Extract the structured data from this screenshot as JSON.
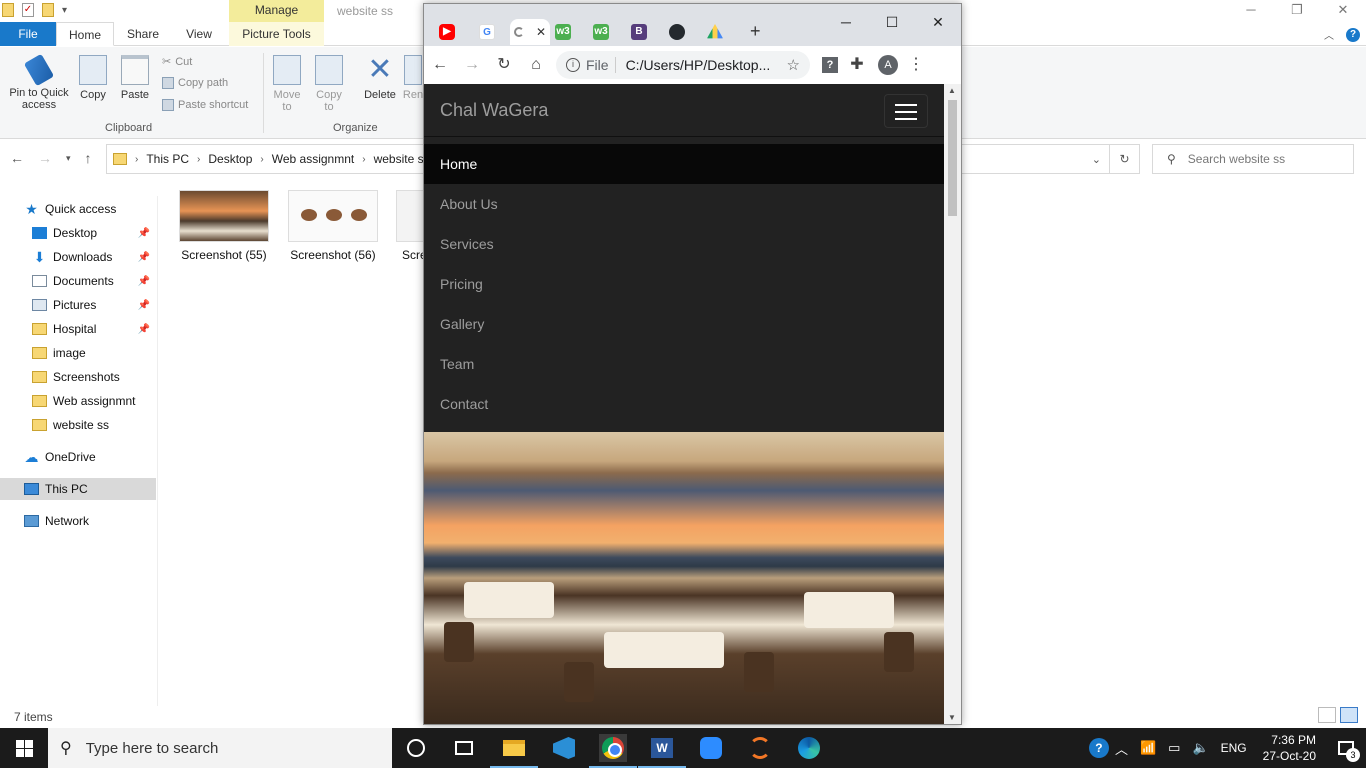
{
  "explorer": {
    "window_title": "website ss",
    "manage_label": "Manage",
    "tabs": {
      "file": "File",
      "home": "Home",
      "share": "Share",
      "view": "View",
      "picture_tools": "Picture Tools"
    },
    "ribbon": {
      "pin": [
        "Pin to Quick",
        "access"
      ],
      "copy": "Copy",
      "paste": "Paste",
      "cut": "Cut",
      "copy_path": "Copy path",
      "paste_shortcut": "Paste shortcut",
      "clipboard_group": "Clipboard",
      "move_to": [
        "Move",
        "to"
      ],
      "copy_to": [
        "Copy",
        "to"
      ],
      "delete": "Delete",
      "rename": "Ren",
      "organize_group": "Organize"
    },
    "breadcrumb": [
      "This PC",
      "Desktop",
      "Web assignmnt",
      "website s"
    ],
    "search_placeholder": "Search website ss",
    "nav": {
      "quick_access": "Quick access",
      "desktop": "Desktop",
      "downloads": "Downloads",
      "documents": "Documents",
      "pictures": "Pictures",
      "hospital": "Hospital",
      "image": "image",
      "screenshots": "Screenshots",
      "web_assignmnt": "Web assignmnt",
      "website_ss": "website ss",
      "onedrive": "OneDrive",
      "this_pc": "This PC",
      "network": "Network"
    },
    "files": [
      "Screenshot (55)",
      "Screenshot (56)",
      "Scre"
    ],
    "status": "7 items"
  },
  "chrome": {
    "address_scheme": "File",
    "address_url": "C:/Users/HP/Desktop...",
    "profile_initial": "A",
    "site": {
      "brand": "Chal WaGera",
      "menu": [
        "Home",
        "About Us",
        "Services",
        "Pricing",
        "Gallery",
        "Team",
        "Contact"
      ],
      "active_index": 0
    }
  },
  "taskbar": {
    "search_placeholder": "Type here to search",
    "language": "ENG",
    "time": "7:36 PM",
    "date": "27-Oct-20",
    "notification_count": "3"
  }
}
